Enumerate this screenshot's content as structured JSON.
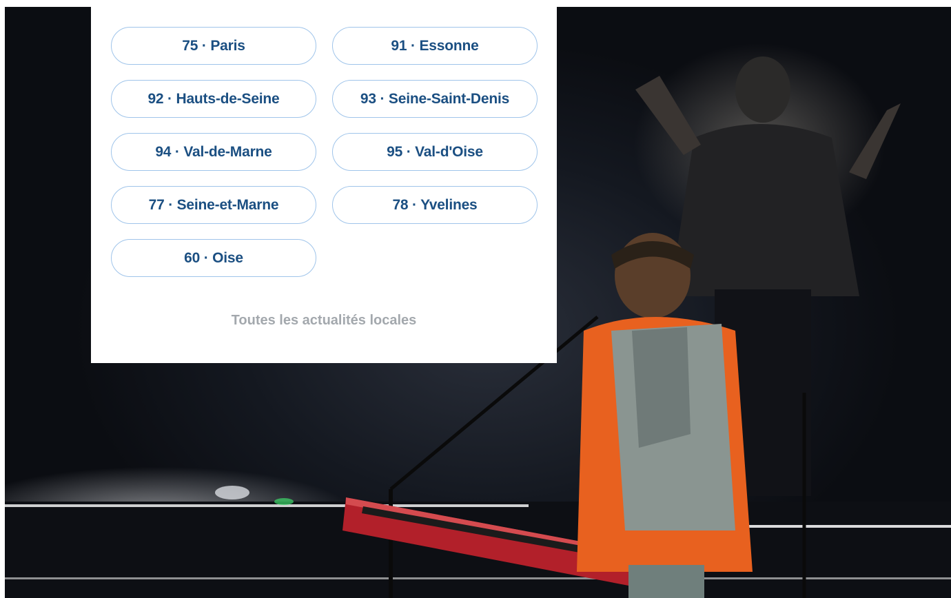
{
  "departments": {
    "items": [
      {
        "label": "75 · Paris"
      },
      {
        "label": "91 · Essonne"
      },
      {
        "label": "92 · Hauts-de-Seine"
      },
      {
        "label": "93 · Seine-Saint-Denis"
      },
      {
        "label": "94 · Val-de-Marne"
      },
      {
        "label": "95 · Val-d'Oise"
      },
      {
        "label": "77 · Seine-et-Marne"
      },
      {
        "label": "78 · Yvelines"
      },
      {
        "label": "60 · Oise"
      }
    ],
    "all_news_label": "Toutes les actualités locales"
  },
  "colors": {
    "pill_text": "#1b4f82",
    "pill_border": "#9fc4ea",
    "link_gray": "#a3a8ad"
  }
}
